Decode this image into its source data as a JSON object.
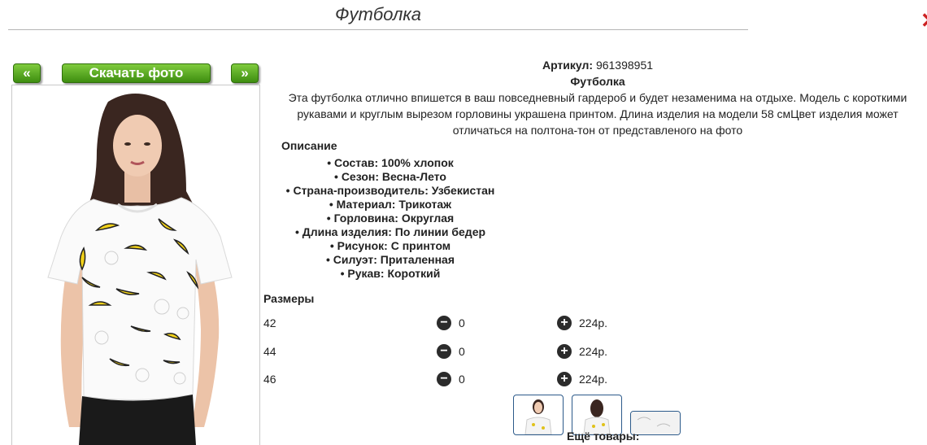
{
  "page": {
    "title": "Футболка"
  },
  "toolbar": {
    "prev_label": "«",
    "download_label": "Скачать фото",
    "next_label": "»"
  },
  "product": {
    "article_label": "Артикул:",
    "article_value": "961398951",
    "name": "Футболка",
    "lead_lines": [
      "Эта футболка отлично впишется в ваш повседневный гардероб и будет незаменима на отдыхе. Модель с короткими",
      "рукавами и круглым вырезом горловины украшена принтом. Длина изделия на модели 58 смЦвет изделия может",
      "отличаться на полтона-тон от представленого на фото"
    ]
  },
  "description": {
    "title": "Описание",
    "items": [
      "• Состав: 100% хлопок",
      "• Сезон: Весна-Лето",
      "• Страна-производитель: Узбекистан",
      "• Материал: Трикотаж",
      "• Горловина: Округлая",
      "• Длина изделия: По линии бедер",
      "• Рисунок: С принтом",
      "• Силуэт: Приталенная",
      "• Рукав: Короткий"
    ]
  },
  "sizes": {
    "title": "Размеры",
    "rows": [
      {
        "size": "42",
        "qty": "0",
        "price": "224р."
      },
      {
        "size": "44",
        "qty": "0",
        "price": "224р."
      },
      {
        "size": "46",
        "qty": "0",
        "price": "224р."
      }
    ]
  },
  "icons": {
    "minus": "minus-circle-icon",
    "plus": "plus-circle-icon",
    "close": "close-icon"
  },
  "colors": {
    "button_green": "#4caf1e",
    "thumb_border": "#2c5a8a",
    "close_red": "#cc2222"
  },
  "more": {
    "label": "Ещё товары:"
  }
}
